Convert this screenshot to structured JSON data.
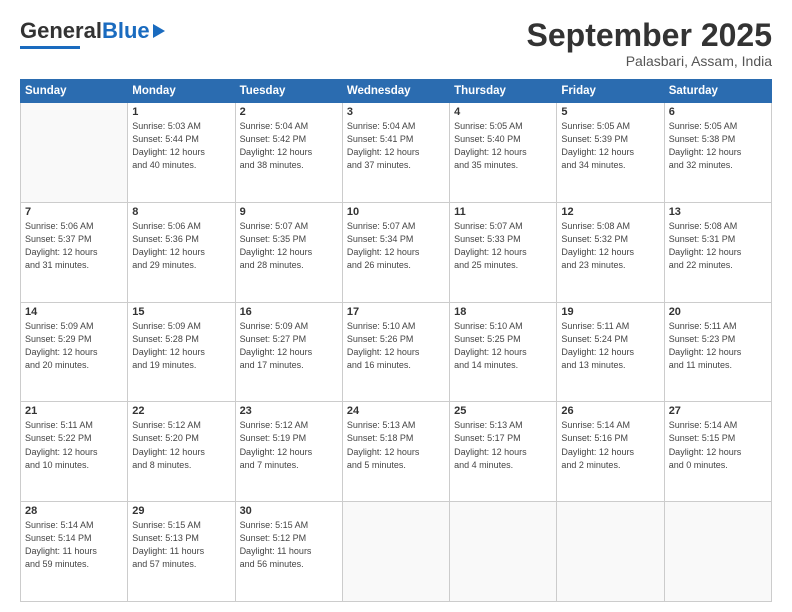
{
  "header": {
    "logo_general": "General",
    "logo_blue": "Blue",
    "month": "September 2025",
    "location": "Palasbari, Assam, India"
  },
  "days_of_week": [
    "Sunday",
    "Monday",
    "Tuesday",
    "Wednesday",
    "Thursday",
    "Friday",
    "Saturday"
  ],
  "weeks": [
    [
      {
        "day": "",
        "info": ""
      },
      {
        "day": "1",
        "info": "Sunrise: 5:03 AM\nSunset: 5:44 PM\nDaylight: 12 hours\nand 40 minutes."
      },
      {
        "day": "2",
        "info": "Sunrise: 5:04 AM\nSunset: 5:42 PM\nDaylight: 12 hours\nand 38 minutes."
      },
      {
        "day": "3",
        "info": "Sunrise: 5:04 AM\nSunset: 5:41 PM\nDaylight: 12 hours\nand 37 minutes."
      },
      {
        "day": "4",
        "info": "Sunrise: 5:05 AM\nSunset: 5:40 PM\nDaylight: 12 hours\nand 35 minutes."
      },
      {
        "day": "5",
        "info": "Sunrise: 5:05 AM\nSunset: 5:39 PM\nDaylight: 12 hours\nand 34 minutes."
      },
      {
        "day": "6",
        "info": "Sunrise: 5:05 AM\nSunset: 5:38 PM\nDaylight: 12 hours\nand 32 minutes."
      }
    ],
    [
      {
        "day": "7",
        "info": "Sunrise: 5:06 AM\nSunset: 5:37 PM\nDaylight: 12 hours\nand 31 minutes."
      },
      {
        "day": "8",
        "info": "Sunrise: 5:06 AM\nSunset: 5:36 PM\nDaylight: 12 hours\nand 29 minutes."
      },
      {
        "day": "9",
        "info": "Sunrise: 5:07 AM\nSunset: 5:35 PM\nDaylight: 12 hours\nand 28 minutes."
      },
      {
        "day": "10",
        "info": "Sunrise: 5:07 AM\nSunset: 5:34 PM\nDaylight: 12 hours\nand 26 minutes."
      },
      {
        "day": "11",
        "info": "Sunrise: 5:07 AM\nSunset: 5:33 PM\nDaylight: 12 hours\nand 25 minutes."
      },
      {
        "day": "12",
        "info": "Sunrise: 5:08 AM\nSunset: 5:32 PM\nDaylight: 12 hours\nand 23 minutes."
      },
      {
        "day": "13",
        "info": "Sunrise: 5:08 AM\nSunset: 5:31 PM\nDaylight: 12 hours\nand 22 minutes."
      }
    ],
    [
      {
        "day": "14",
        "info": "Sunrise: 5:09 AM\nSunset: 5:29 PM\nDaylight: 12 hours\nand 20 minutes."
      },
      {
        "day": "15",
        "info": "Sunrise: 5:09 AM\nSunset: 5:28 PM\nDaylight: 12 hours\nand 19 minutes."
      },
      {
        "day": "16",
        "info": "Sunrise: 5:09 AM\nSunset: 5:27 PM\nDaylight: 12 hours\nand 17 minutes."
      },
      {
        "day": "17",
        "info": "Sunrise: 5:10 AM\nSunset: 5:26 PM\nDaylight: 12 hours\nand 16 minutes."
      },
      {
        "day": "18",
        "info": "Sunrise: 5:10 AM\nSunset: 5:25 PM\nDaylight: 12 hours\nand 14 minutes."
      },
      {
        "day": "19",
        "info": "Sunrise: 5:11 AM\nSunset: 5:24 PM\nDaylight: 12 hours\nand 13 minutes."
      },
      {
        "day": "20",
        "info": "Sunrise: 5:11 AM\nSunset: 5:23 PM\nDaylight: 12 hours\nand 11 minutes."
      }
    ],
    [
      {
        "day": "21",
        "info": "Sunrise: 5:11 AM\nSunset: 5:22 PM\nDaylight: 12 hours\nand 10 minutes."
      },
      {
        "day": "22",
        "info": "Sunrise: 5:12 AM\nSunset: 5:20 PM\nDaylight: 12 hours\nand 8 minutes."
      },
      {
        "day": "23",
        "info": "Sunrise: 5:12 AM\nSunset: 5:19 PM\nDaylight: 12 hours\nand 7 minutes."
      },
      {
        "day": "24",
        "info": "Sunrise: 5:13 AM\nSunset: 5:18 PM\nDaylight: 12 hours\nand 5 minutes."
      },
      {
        "day": "25",
        "info": "Sunrise: 5:13 AM\nSunset: 5:17 PM\nDaylight: 12 hours\nand 4 minutes."
      },
      {
        "day": "26",
        "info": "Sunrise: 5:14 AM\nSunset: 5:16 PM\nDaylight: 12 hours\nand 2 minutes."
      },
      {
        "day": "27",
        "info": "Sunrise: 5:14 AM\nSunset: 5:15 PM\nDaylight: 12 hours\nand 0 minutes."
      }
    ],
    [
      {
        "day": "28",
        "info": "Sunrise: 5:14 AM\nSunset: 5:14 PM\nDaylight: 11 hours\nand 59 minutes."
      },
      {
        "day": "29",
        "info": "Sunrise: 5:15 AM\nSunset: 5:13 PM\nDaylight: 11 hours\nand 57 minutes."
      },
      {
        "day": "30",
        "info": "Sunrise: 5:15 AM\nSunset: 5:12 PM\nDaylight: 11 hours\nand 56 minutes."
      },
      {
        "day": "",
        "info": ""
      },
      {
        "day": "",
        "info": ""
      },
      {
        "day": "",
        "info": ""
      },
      {
        "day": "",
        "info": ""
      }
    ]
  ]
}
